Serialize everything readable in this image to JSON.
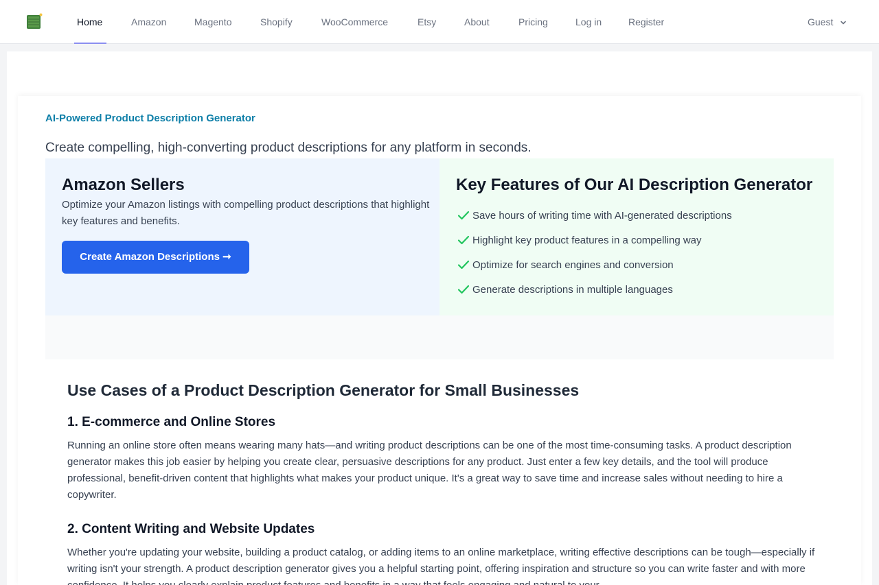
{
  "nav": {
    "logo_icon": "app-logo-icon",
    "items": [
      {
        "label": "Home",
        "active": true
      },
      {
        "label": "Amazon"
      },
      {
        "label": "Magento"
      },
      {
        "label": "Shopify"
      },
      {
        "label": "WooCommerce"
      },
      {
        "label": "Etsy"
      },
      {
        "label": "About"
      },
      {
        "label": "Pricing"
      },
      {
        "label": "Log in"
      },
      {
        "label": "Register"
      }
    ],
    "user_menu": {
      "label": "Guest",
      "icon": "chevron-down-icon"
    }
  },
  "hero": {
    "kicker": "AI-Powered Product Description Generator",
    "subtitle": "Create compelling, high-converting product descriptions for any platform in seconds."
  },
  "amazon_panel": {
    "title": "Amazon Sellers",
    "text": "Optimize your Amazon listings with compelling product descriptions that highlight key features and benefits.",
    "button_label": "Create Amazon Descriptions ➞"
  },
  "features_panel": {
    "title": "Key Features of Our AI Description Generator",
    "icon": "check-icon",
    "items": [
      "Save hours of writing time with AI-generated descriptions",
      "Highlight key product features in a compelling way",
      "Optimize for search engines and conversion",
      "Generate descriptions in multiple languages"
    ]
  },
  "use_cases": {
    "title": "Use Cases of a Product Description Generator for Small Businesses",
    "sections": [
      {
        "heading": "1. E-commerce and Online Stores",
        "text": "Running an online store often means wearing many hats—and writing product descriptions can be one of the most time-consuming tasks. A product description generator makes this job easier by helping you create clear, persuasive descriptions for any product. Just enter a few key details, and the tool will produce professional, benefit-driven content that highlights what makes your product unique. It's a great way to save time and increase sales without needing to hire a copywriter."
      },
      {
        "heading": "2. Content Writing and Website Updates",
        "text": "Whether you're updating your website, building a product catalog, or adding items to an online marketplace, writing effective descriptions can be tough—especially if writing isn't your strength. A product description generator gives you a helpful starting point, offering inspiration and structure so you can write faster and with more confidence. It helps you clearly explain product features and benefits in a way that feels engaging and natural to your"
      }
    ]
  },
  "colors": {
    "accent": "#2563eb",
    "kicker": "#0e7fa8",
    "check": "#22c55e",
    "nav_active_underline": "#6366f1"
  }
}
